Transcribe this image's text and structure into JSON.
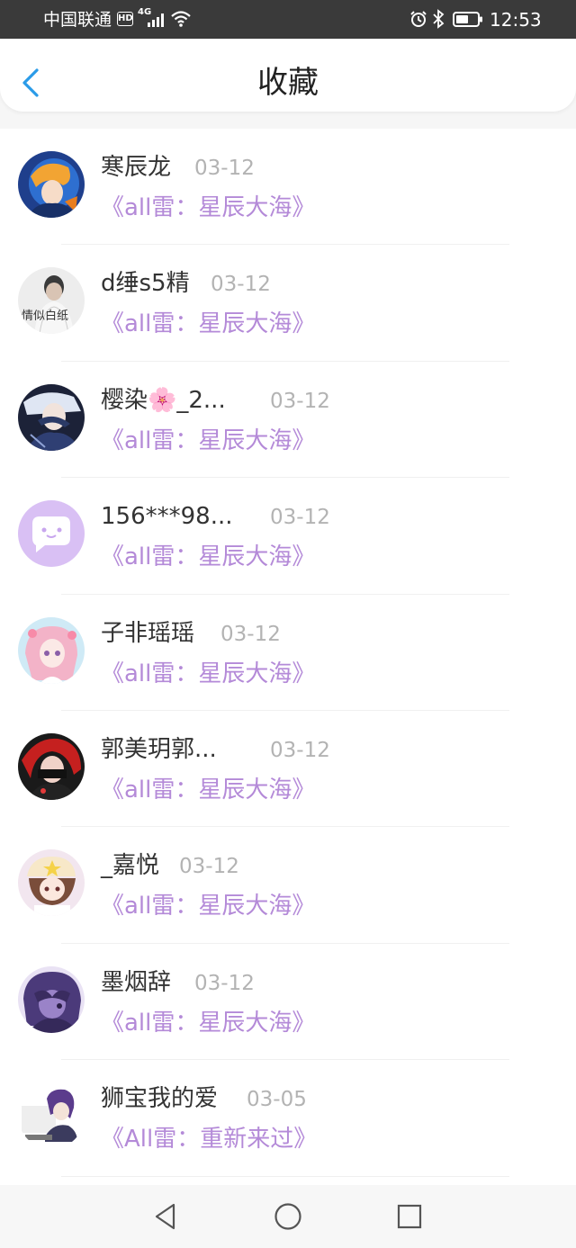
{
  "status_bar": {
    "carrier": "中国联通",
    "hd": "HD",
    "network": "4G",
    "time": "12:53"
  },
  "header": {
    "title": "收藏",
    "back_icon": "chevron-left-icon"
  },
  "colors": {
    "accent": "#2a9be8",
    "link": "#b48ad8",
    "date": "#b3b3b3",
    "username": "#333333"
  },
  "favorites": [
    {
      "username": "寒辰龙",
      "date": "03-12",
      "story": "《all雷：星辰大海》"
    },
    {
      "username": "d缍s5精",
      "date": "03-12",
      "story": "《all雷：星辰大海》"
    },
    {
      "username": "樱染🌸_2...",
      "date": "03-12",
      "story": "《all雷：星辰大海》"
    },
    {
      "username": "156***98...",
      "date": "03-12",
      "story": "《all雷：星辰大海》"
    },
    {
      "username": "子非瑶瑶",
      "date": "03-12",
      "story": "《all雷：星辰大海》"
    },
    {
      "username": "郭美玥郭...",
      "date": "03-12",
      "story": "《all雷：星辰大海》"
    },
    {
      "username": "_嘉悦",
      "date": "03-12",
      "story": "《all雷：星辰大海》"
    },
    {
      "username": "墨烟辞",
      "date": "03-12",
      "story": "《all雷：星辰大海》"
    },
    {
      "username": "狮宝我的爱",
      "date": "03-05",
      "story": "《All雷：重新来过》"
    }
  ],
  "avatar2_text": "情似白纸",
  "nav": {
    "back": "triangle-back-icon",
    "home": "circle-home-icon",
    "recents": "square-recents-icon"
  }
}
